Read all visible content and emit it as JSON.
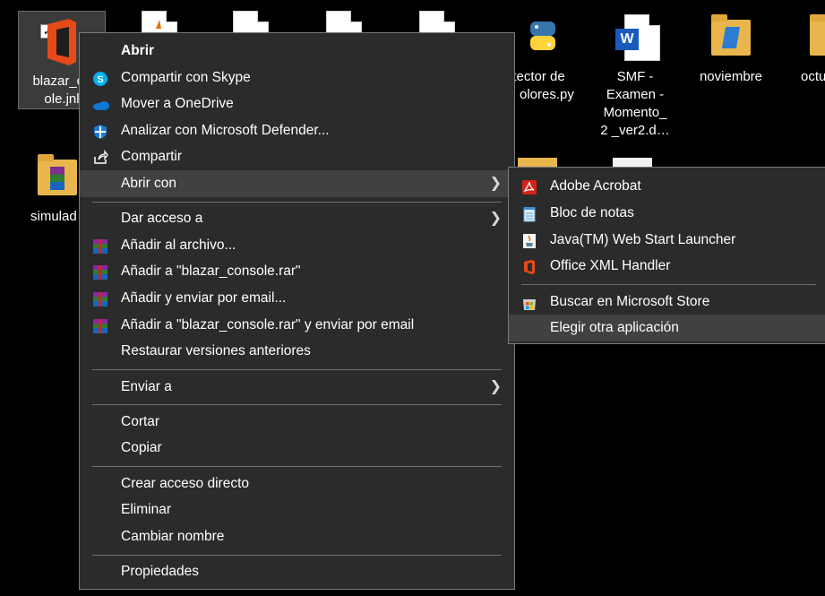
{
  "desktop": {
    "icons": [
      {
        "label_line1": "blazar_co",
        "label_line2": "ole.jnl"
      },
      {
        "label": "simulad"
      },
      {
        "label_line1": "etector de",
        "label_line2": "olores.py"
      },
      {
        "label_lines": [
          "SMF -",
          "Examen -",
          "Momento_",
          "2 _ver2.d…"
        ]
      },
      {
        "label": "noviembre"
      },
      {
        "label": "octu"
      }
    ]
  },
  "context_menu": {
    "items": [
      {
        "label": "Abrir",
        "bold": true
      },
      {
        "label": "Compartir con Skype"
      },
      {
        "label": "Mover a OneDrive"
      },
      {
        "label": "Analizar con Microsoft Defender..."
      },
      {
        "label": "Compartir"
      },
      {
        "label": "Abrir con"
      },
      {
        "label": "Dar acceso a"
      },
      {
        "label": "Añadir al archivo..."
      },
      {
        "label": "Añadir a \"blazar_console.rar\""
      },
      {
        "label": "Añadir y enviar por email..."
      },
      {
        "label": "Añadir a \"blazar_console.rar\" y enviar por email"
      },
      {
        "label": "Restaurar versiones anteriores"
      },
      {
        "label": "Enviar a"
      },
      {
        "label": "Cortar"
      },
      {
        "label": "Copiar"
      },
      {
        "label": "Crear acceso directo"
      },
      {
        "label": "Eliminar"
      },
      {
        "label": "Cambiar nombre"
      },
      {
        "label": "Propiedades"
      }
    ],
    "submenu_arrow": "❯"
  },
  "submenu": {
    "items": [
      {
        "label": "Adobe Acrobat"
      },
      {
        "label": "Bloc de notas"
      },
      {
        "label": "Java(TM) Web Start Launcher"
      },
      {
        "label": "Office XML Handler"
      },
      {
        "label": "Buscar en Microsoft Store"
      },
      {
        "label": "Elegir otra aplicación"
      }
    ]
  },
  "colors": {
    "menu_bg": "#2b2b2b",
    "highlight": "#414141",
    "office_orange": "#e64a19",
    "skype_blue": "#00aff0",
    "onedrive_blue": "#0f78d4",
    "acrobat_red": "#d4241c"
  }
}
